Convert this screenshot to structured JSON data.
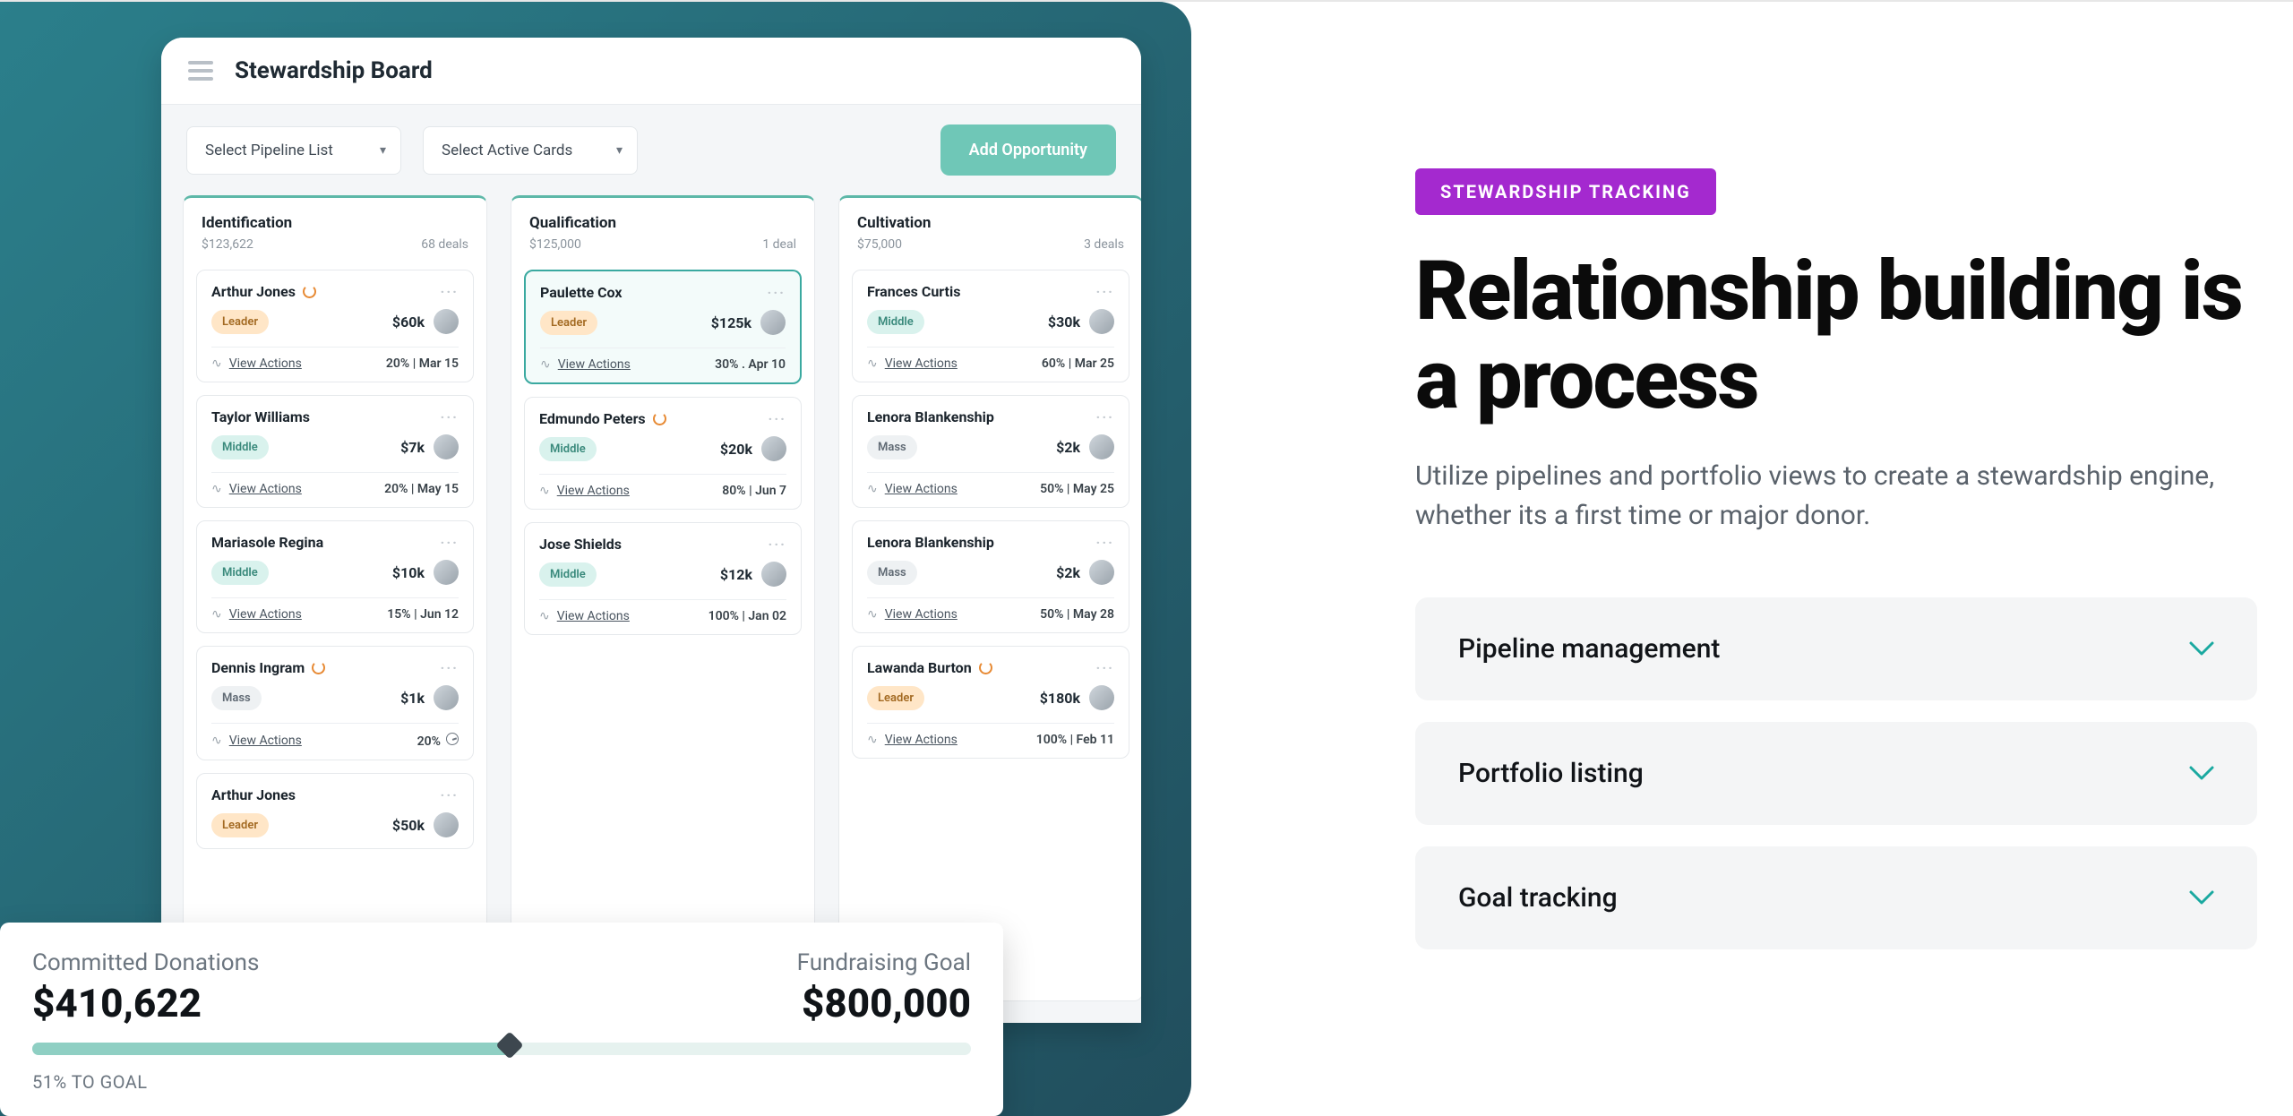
{
  "left": {
    "title": "Stewardship Board",
    "select_pipeline": "Select Pipeline List",
    "select_active": "Select Active Cards",
    "add_btn": "Add Opportunity",
    "columns": [
      {
        "title": "Identification",
        "amount": "$123,622",
        "deals": "68 deals",
        "cards": [
          {
            "name": "Arthur Jones",
            "ring": true,
            "tag": "Leader",
            "tag_class": "leader",
            "amt": "$60k",
            "va": "View Actions",
            "foot": "20% | Mar 15"
          },
          {
            "name": "Taylor Williams",
            "ring": false,
            "tag": "Middle",
            "tag_class": "middle",
            "amt": "$7k",
            "va": "View Actions",
            "foot": "20% | May 15"
          },
          {
            "name": "Mariasole Regina",
            "ring": false,
            "tag": "Middle",
            "tag_class": "middle",
            "amt": "$10k",
            "va": "View Actions",
            "foot": "15% | Jun 12"
          },
          {
            "name": "Dennis Ingram",
            "ring": true,
            "tag": "Mass",
            "tag_class": "mass",
            "amt": "$1k",
            "va": "View Actions",
            "foot": "20%",
            "clock": true
          },
          {
            "name": "Arthur Jones",
            "ring": false,
            "tag": "Leader",
            "tag_class": "leader",
            "amt": "$50k",
            "va": "",
            "foot": "",
            "trunc": true
          }
        ]
      },
      {
        "title": "Qualification",
        "amount": "$125,000",
        "deals": "1 deal",
        "cards": [
          {
            "name": "Paulette Cox",
            "ring": false,
            "tag": "Leader",
            "tag_class": "leader",
            "amt": "$125k",
            "va": "View Actions",
            "foot": "30% . Apr 10",
            "highlight": true
          },
          {
            "name": "Edmundo Peters",
            "ring": true,
            "tag": "Middle",
            "tag_class": "middle",
            "amt": "$20k",
            "va": "View Actions",
            "foot": "80% | Jun 7"
          },
          {
            "name": "Jose Shields",
            "ring": false,
            "tag": "Middle",
            "tag_class": "middle",
            "amt": "$12k",
            "va": "View Actions",
            "foot": "100% | Jan 02"
          }
        ]
      },
      {
        "title": "Cultivation",
        "amount": "$75,000",
        "deals": "3 deals",
        "cards": [
          {
            "name": "Frances Curtis",
            "ring": false,
            "tag": "Middle",
            "tag_class": "middle",
            "amt": "$30k",
            "va": "View Actions",
            "foot": "60% | Mar 25"
          },
          {
            "name": "Lenora Blankenship",
            "ring": false,
            "tag": "Mass",
            "tag_class": "mass",
            "amt": "$2k",
            "va": "View Actions",
            "foot": "50% | May 25"
          },
          {
            "name": "Lenora Blankenship",
            "ring": false,
            "tag": "Mass",
            "tag_class": "mass",
            "amt": "$2k",
            "va": "View Actions",
            "foot": "50% | May 28"
          },
          {
            "name": "Lawanda Burton",
            "ring": true,
            "tag": "Leader",
            "tag_class": "leader",
            "amt": "$180k",
            "va": "View Actions",
            "foot": "100% | Feb 11"
          }
        ]
      }
    ],
    "progress": {
      "left_label": "Committed Donations",
      "left_value": "$410,622",
      "right_label": "Fundraising Goal",
      "right_value": "$800,000",
      "pct_label": "51% TO GOAL",
      "pct": 51
    }
  },
  "right": {
    "pill": "STEWARDSHIP TRACKING",
    "headline": "Relationship building is a process",
    "sub": "Utilize pipelines and portfolio views to create a stewardship engine, whether its a first time or major donor.",
    "accordion": [
      "Pipeline management",
      "Portfolio listing",
      "Goal tracking"
    ]
  }
}
